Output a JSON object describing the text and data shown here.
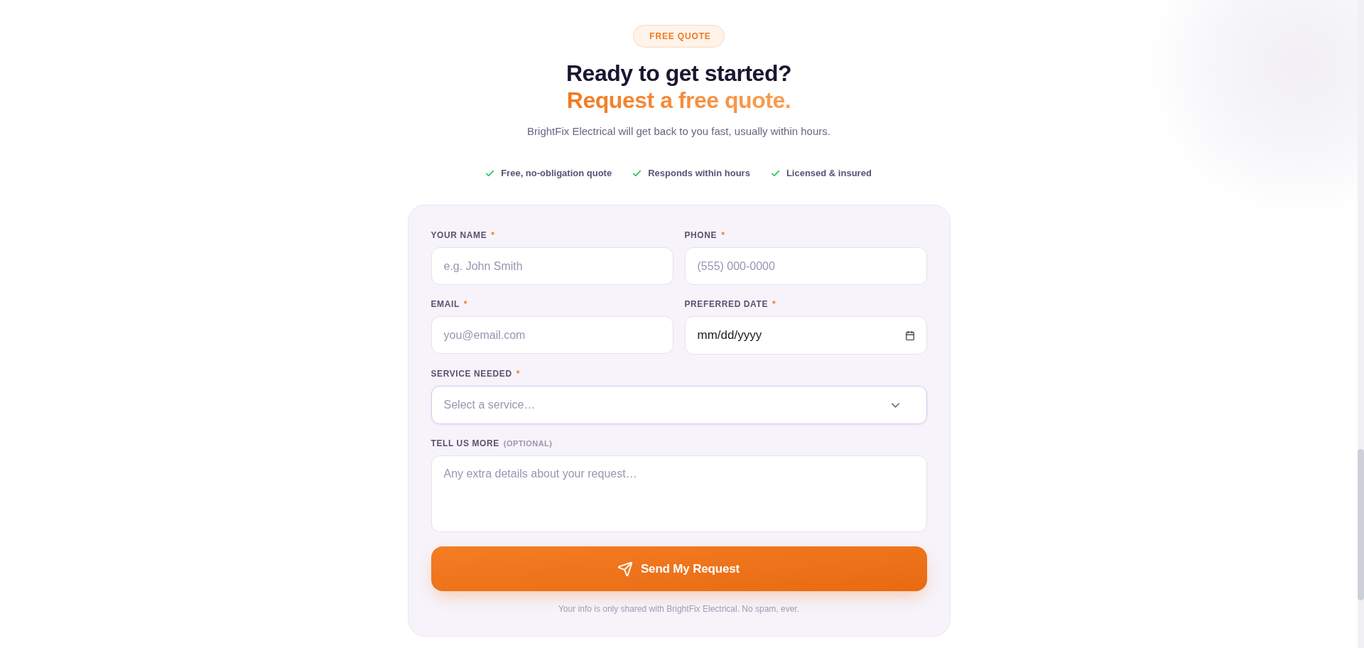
{
  "badge": {
    "label": "FREE QUOTE"
  },
  "heading": {
    "line_1": "Ready to get started?",
    "line_2": "Request a free quote."
  },
  "subtitle": "BrightFix Electrical will get back to you fast, usually within hours.",
  "highlights": [
    {
      "label": "Free, no-obligation quote"
    },
    {
      "label": "Responds within hours"
    },
    {
      "label": "Licensed & insured"
    }
  ],
  "form": {
    "fields": [
      {
        "kind": "text",
        "label": "YOUR NAME",
        "required_mark": "*",
        "placeholder": "e.g. John Smith"
      },
      {
        "kind": "text",
        "label": "PHONE",
        "required_mark": "*",
        "placeholder": "(555) 000-0000"
      },
      {
        "kind": "text",
        "label": "EMAIL",
        "required_mark": "*",
        "placeholder": "you@email.com"
      },
      {
        "kind": "date",
        "label": "PREFERRED DATE",
        "required_mark": "*",
        "placeholder": "mm/dd/yyyy"
      },
      {
        "kind": "select",
        "label": "SERVICE NEEDED",
        "required_mark": "*",
        "placeholder": "Select a service…"
      },
      {
        "kind": "textarea",
        "label": "TELL US MORE",
        "note": "(OPTIONAL)",
        "placeholder": "Any extra details about your request…"
      }
    ],
    "submit_button": {
      "label": "Send My Request"
    },
    "privacy_note": "Your info is only shared with BrightFix Electrical. No spam, ever."
  }
}
